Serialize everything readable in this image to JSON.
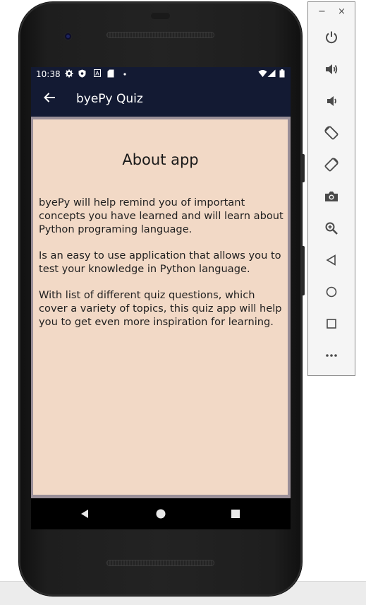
{
  "status_bar": {
    "time": "10:38",
    "icons": [
      "settings-icon",
      "shield-icon",
      "a-icon",
      "sd-card-icon",
      "dot-icon",
      "wifi-icon",
      "signal-icon",
      "battery-icon"
    ]
  },
  "app_bar": {
    "title": "byePy Quiz",
    "back_icon": "arrow-left-icon"
  },
  "content": {
    "heading": "About app",
    "paragraphs": [
      "byePy will help remind you of important concepts you have learned and will learn about Python programing language.",
      "Is an easy to use application that allows you to test your knowledge in Python language.",
      "With list of different quiz questions, which cover a variety of topics, this quiz app will help you to get even more inspiration for learning."
    ],
    "background": "#f2d9c6"
  },
  "nav_bar": {
    "buttons": [
      "back-triangle-icon",
      "home-circle-icon",
      "recents-square-icon"
    ]
  },
  "emulator_panel": {
    "window_controls": {
      "minimize": "−",
      "close": "×"
    },
    "buttons": [
      "power-icon",
      "volume-up-icon",
      "volume-down-icon",
      "rotate-left-icon",
      "rotate-right-icon",
      "camera-icon",
      "zoom-icon",
      "back-icon",
      "home-icon",
      "overview-icon",
      "more-icon"
    ]
  },
  "colors": {
    "app_bar": "#131a33",
    "card": "#f2d9c6",
    "panel_icon": "#4a4a4a"
  }
}
